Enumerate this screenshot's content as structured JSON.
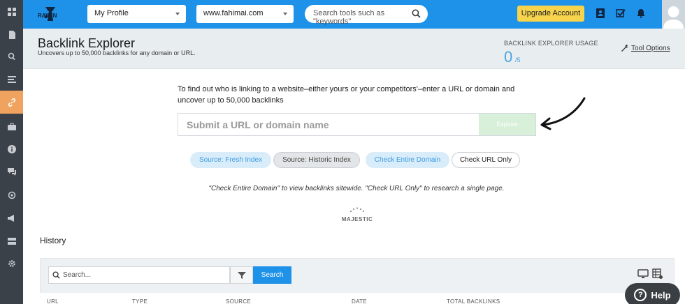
{
  "topbar": {
    "logo_text": "RAVEN",
    "profile_select": "My Profile",
    "domain_select": "www.fahimai.com",
    "tool_search_placeholder": "Search tools such as \"keywords\"",
    "upgrade_label": "Upgrade Account",
    "icons": [
      "contacts-icon",
      "tasks-check-icon",
      "notifications-bell-icon"
    ]
  },
  "sidebar": {
    "items": [
      {
        "icon": "dashboard-grid-icon"
      },
      {
        "icon": "document-icon"
      },
      {
        "icon": "search-icon"
      },
      {
        "icon": "list-report-icon"
      },
      {
        "icon": "link-icon",
        "active": true
      },
      {
        "icon": "briefcase-icon"
      },
      {
        "icon": "info-icon"
      },
      {
        "icon": "chat-icon"
      },
      {
        "icon": "target-icon"
      },
      {
        "icon": "megaphone-icon"
      },
      {
        "icon": "layout-icon"
      },
      {
        "icon": "settings-gear-icon"
      }
    ]
  },
  "header": {
    "title": "Backlink Explorer",
    "subtitle": "Uncovers up to 50,000 backlinks for any domain or URL.",
    "usage_label": "BACKLINK EXPLORER USAGE",
    "usage_count": "0",
    "usage_max": "/5",
    "tool_options": "Tool Options"
  },
  "main": {
    "intro": "To find out who is linking to a website–either yours or your competitors'–enter a URL or domain and uncover up to 50,000 backlinks",
    "url_placeholder": "Submit a URL or domain name",
    "explore_label": "Explore",
    "pills": {
      "fresh": "Source: Fresh Index",
      "historic": "Source: Historic Index",
      "entire_domain": "Check Entire Domain",
      "url_only": "Check URL Only"
    },
    "hint": "\"Check Entire Domain\" to view backlinks sitewide. \"Check URL Only\" to research a single page.",
    "majestic": "MAJESTIC"
  },
  "history": {
    "title": "History",
    "search_placeholder": "Search...",
    "search_button": "Search",
    "columns": [
      "URL",
      "TYPE",
      "SOURCE",
      "DATE",
      "TOTAL BACKLINKS"
    ]
  },
  "help": {
    "label": "Help"
  },
  "colors": {
    "topbar": "#1e91e9",
    "sidebar": "#3b4148",
    "active_nav": "#f0a35e",
    "upgrade": "#f7d44c",
    "accent_blue": "#4aa3df"
  }
}
